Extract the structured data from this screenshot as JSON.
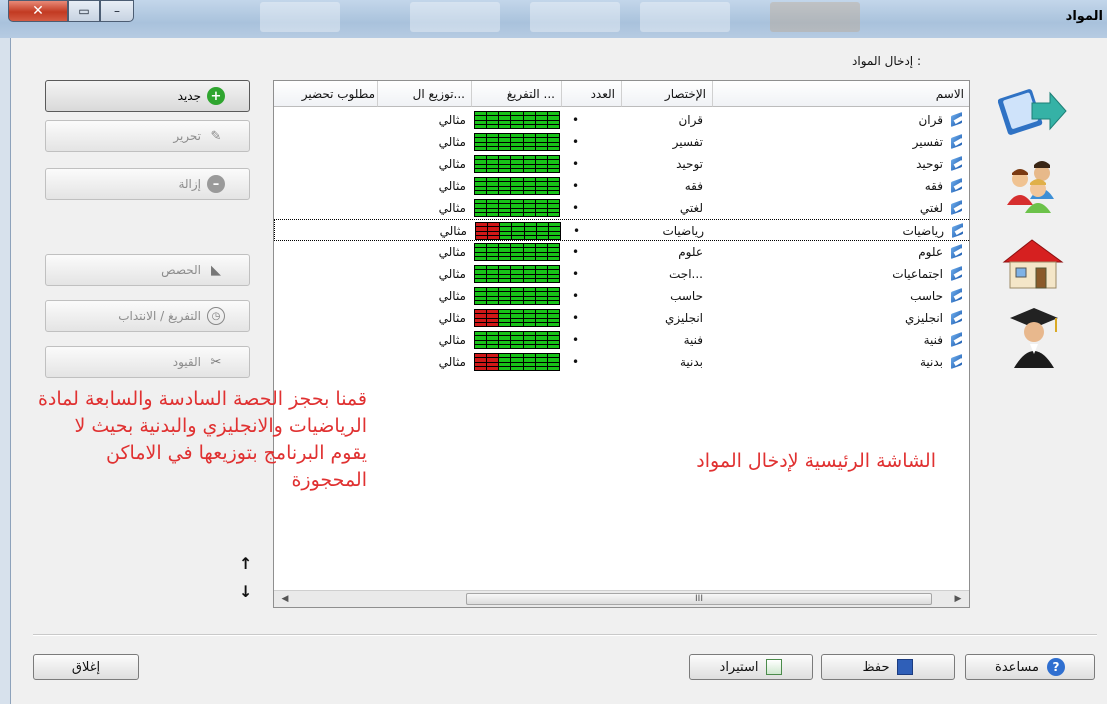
{
  "window": {
    "title": "المواد"
  },
  "section_label": "إدخال المواد :",
  "columns": [
    "الاسم",
    "الإختصار",
    "العدد",
    "التفريغ ...",
    "توزيع ال...",
    "مطلوب تحضير"
  ],
  "rows": [
    {
      "name": "قران",
      "abbr": "قران",
      "count": "•",
      "dist": "مثالي",
      "red_cells": []
    },
    {
      "name": "تفسير",
      "abbr": "تفسير",
      "count": "•",
      "dist": "مثالي",
      "red_cells": []
    },
    {
      "name": "توحيد",
      "abbr": "توحيد",
      "count": "•",
      "dist": "مثالي",
      "red_cells": []
    },
    {
      "name": "فقه",
      "abbr": "فقه",
      "count": "•",
      "dist": "مثالي",
      "red_cells": []
    },
    {
      "name": "لغتي",
      "abbr": "لغتي",
      "count": "•",
      "dist": "مثالي",
      "red_cells": []
    },
    {
      "name": "رياضيات",
      "abbr": "رياضيات",
      "count": "•",
      "dist": "مثالي",
      "red_cells": [
        0,
        1
      ]
    },
    {
      "name": "علوم",
      "abbr": "علوم",
      "count": "•",
      "dist": "مثالي",
      "red_cells": []
    },
    {
      "name": "اجتماعيات",
      "abbr": "اجت...",
      "count": "•",
      "dist": "مثالي",
      "red_cells": []
    },
    {
      "name": "حاسب",
      "abbr": "حاسب",
      "count": "•",
      "dist": "مثالي",
      "red_cells": []
    },
    {
      "name": "انجليزي",
      "abbr": "انجليزي",
      "count": "•",
      "dist": "مثالي",
      "red_cells": [
        0,
        1
      ]
    },
    {
      "name": "فنية",
      "abbr": "فنية",
      "count": "•",
      "dist": "مثالي",
      "red_cells": []
    },
    {
      "name": "بدنية",
      "abbr": "بدنية",
      "count": "•",
      "dist": "مثالي",
      "red_cells": [
        0,
        1
      ]
    }
  ],
  "selected_row": 5,
  "scroll_thumb_label": "III",
  "buttons": {
    "new": "جديد",
    "edit": "تحرير",
    "remove": "إزالة",
    "periods": "الحصص",
    "release": "التفريغ / الانتداب",
    "constraints": "القيود"
  },
  "annotation_left": "قمنا بحجز الحصة السادسة والسابعة لمادة الرياضيات والانجليزي والبدنية بحيث لا يقوم البرنامج بتوزيعها في الاماكن المحجوزة",
  "annotation_right": "الشاشة الرئيسية لإدخال المواد",
  "arrows": {
    "up": "↑",
    "down": "↓"
  },
  "bottom": {
    "close": "إغلاق",
    "import": "استيراد",
    "save": "حفظ",
    "help": "مساعدة"
  },
  "colors": {
    "grid_green": "#18c318",
    "grid_red": "#d01818",
    "annotation": "#e03131"
  }
}
